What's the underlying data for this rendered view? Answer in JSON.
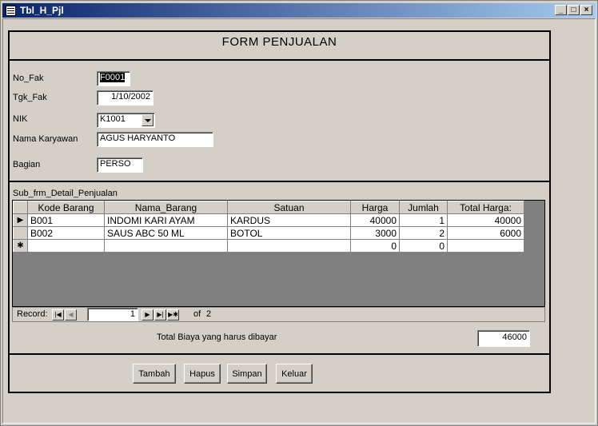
{
  "window": {
    "title": "Tbl_H_Pjl",
    "min": "_",
    "max": "□",
    "close": "×"
  },
  "form": {
    "title": "FORM PENJUALAN"
  },
  "fields": {
    "no_fak": {
      "label": "No_Fak",
      "value": "F0001"
    },
    "tgl_fak": {
      "label": "Tgk_Fak",
      "value": "1/10/2002"
    },
    "nik": {
      "label": "NIK",
      "value": "K1001"
    },
    "nama_karyawan": {
      "label": "Nama Karyawan",
      "value": "AGUS HARYANTO"
    },
    "bagian": {
      "label": "Bagian",
      "value": "PERSO"
    }
  },
  "subform": {
    "label": "Sub_frm_Detail_Penjualan",
    "columns": [
      "Kode Barang",
      "Nama_Barang",
      "Satuan",
      "Harga",
      "Jumlah",
      "Total Harga:"
    ],
    "rows": [
      {
        "selector": "▶",
        "kode": "B001",
        "nama": "INDOMI KARI AYAM",
        "satuan": "KARDUS",
        "harga": "40000",
        "jumlah": "1",
        "total": "40000"
      },
      {
        "selector": "",
        "kode": "B002",
        "nama": "SAUS ABC 50 ML",
        "satuan": "BOTOL",
        "harga": "3000",
        "jumlah": "2",
        "total": "6000"
      },
      {
        "selector": "✱",
        "kode": "",
        "nama": "",
        "satuan": "",
        "harga": "0",
        "jumlah": "0",
        "total": ""
      }
    ],
    "nav": {
      "record_label": "Record:",
      "current": "1",
      "of_label": "of",
      "total": "2"
    }
  },
  "total": {
    "label": "Total Biaya yang harus dibayar",
    "value": "46000"
  },
  "buttons": {
    "tambah": "Tambah",
    "hapus": "Hapus",
    "simpan": "Simpan",
    "keluar": "Keluar"
  }
}
